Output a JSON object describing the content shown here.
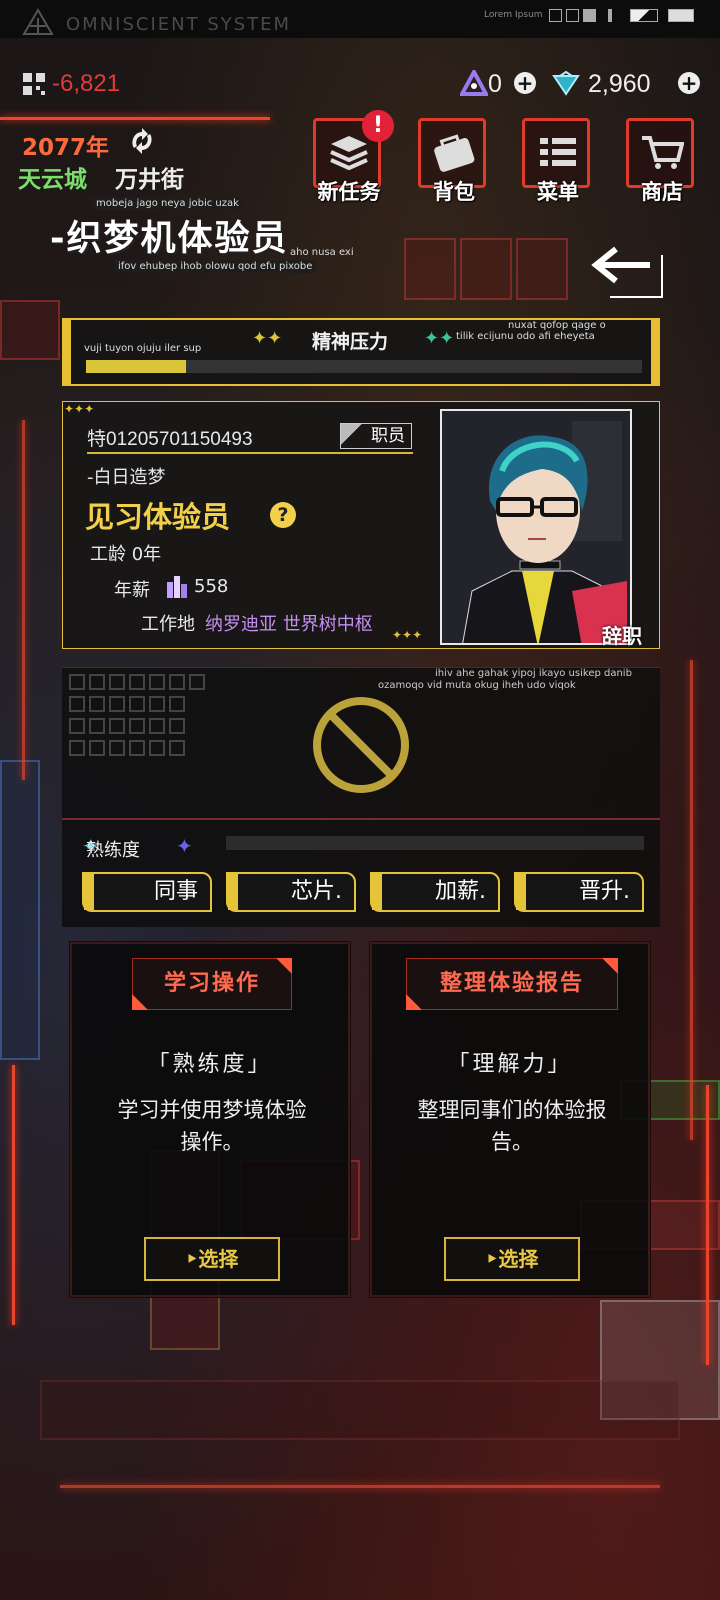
{
  "status": {
    "system_title": "OMNISCIENT SYSTEM",
    "lorem": "Lorem Ipsum"
  },
  "top": {
    "debt": "-6,821",
    "currency_a": "0",
    "currency_b": "2,960",
    "plus": "+"
  },
  "location": {
    "year": "2077年",
    "city": "天云城",
    "street": "万井街"
  },
  "job": {
    "title": "-织梦机体验员",
    "sub1": "mobeja jago neya jobic uzak",
    "sub2": "aho nusa exi",
    "sub3": "ifov ehubep ihob olowu qod efu pixobe"
  },
  "nav": {
    "new_task": "新任务",
    "bag": "背包",
    "menu": "菜单",
    "shop": "商店",
    "alert": "!"
  },
  "icons": {
    "sparkle_left": "✦✦",
    "sparkle_right": "✦✦",
    "dots": "✦✦✦",
    "star4": "✦"
  },
  "stress": {
    "title": "精神压力",
    "sub_left": "vuji tuyon ojuju iler sup",
    "sub_right1": "nuxat qofop qage o",
    "sub_right2": "tilik ecijunu odo afi eheyeta",
    "level_fraction": 0.18
  },
  "card": {
    "id": "特01205701150493",
    "rank": "职员",
    "motto": "-白日造梦",
    "position": "见习体验员",
    "help": "?",
    "seniority": "工龄 0年",
    "salary_label": "年薪",
    "salary": "558",
    "workplace_label": "工作地",
    "workplace": "纳罗迪亚 世界树中枢",
    "quit": "辞职"
  },
  "skills": {
    "sub1": "ihiv ahe gahak yipoj ikayo usikep danib",
    "sub2": "ozamoqo vid muta okug iheh udo viqok",
    "proficiency_label": "熟练度",
    "tabs": [
      "同事",
      "芯片.",
      "加薪.",
      "晋升."
    ]
  },
  "actions": [
    {
      "heading": "学习操作",
      "stat": "「熟练度」",
      "desc": "学习并使用梦境体验操作。",
      "button": "‣选择"
    },
    {
      "heading": "整理体验报告",
      "stat": "「理解力」",
      "desc": "整理同事们的体验报告。",
      "button": "‣选择"
    }
  ],
  "colors": {
    "accent_red": "#e8472e",
    "accent_gold": "#e4c53a",
    "debt_red": "#e23a3a",
    "city_green": "#7cde6a",
    "year_orange": "#ff6a3d",
    "workplace_purple": "#c48ef0"
  }
}
